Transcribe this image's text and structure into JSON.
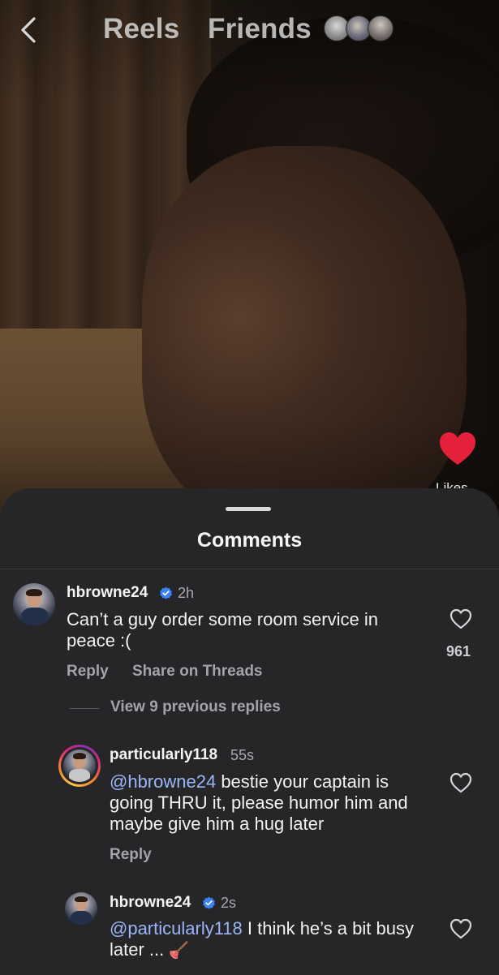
{
  "top_nav": {
    "tabs": [
      "Reels",
      "Friends"
    ],
    "back_icon": "chevron-left-icon"
  },
  "video": {
    "likes_label": "Likes"
  },
  "colors": {
    "sheet_bg": "#262629",
    "heart": "#e5203a",
    "mention": "#9ab6f7",
    "verified": "#3b82f6"
  },
  "comments_sheet": {
    "title": "Comments",
    "comments": [
      {
        "username": "hbrowne24",
        "verified": true,
        "time": "2h",
        "text": "Can’t a guy order some room service in peace :(",
        "likes": "961",
        "actions": [
          "Reply",
          "Share on Threads"
        ]
      }
    ],
    "view_replies": "View 9 previous replies",
    "replies": [
      {
        "username": "particularly118",
        "verified": false,
        "time": "55s",
        "mention": "@hbrowne24",
        "text": " bestie your captain is going THRU it, please humor him and maybe give him a hug later",
        "action": "Reply"
      },
      {
        "username": "hbrowne24",
        "verified": true,
        "time": "2s",
        "mention": "@particularly118",
        "text": " I think he’s a bit busy later ... ",
        "emoji": "🪠"
      }
    ]
  }
}
